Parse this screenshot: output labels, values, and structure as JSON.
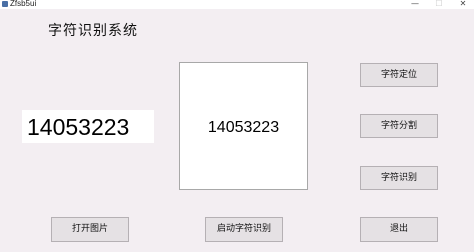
{
  "window": {
    "title": "Zfsb5ui",
    "minimize_glyph": "—",
    "maximize_glyph": "☐",
    "close_glyph": "✕"
  },
  "app": {
    "heading": "字符识别系统"
  },
  "result": {
    "text": "14053223"
  },
  "image_panel": {
    "image_text": "14053223"
  },
  "buttons": {
    "locate": "字符定位",
    "segment": "字符分割",
    "recognize": "字符识别",
    "open_image": "打开图片",
    "start_recognition": "启动字符识别",
    "exit": "退出"
  }
}
